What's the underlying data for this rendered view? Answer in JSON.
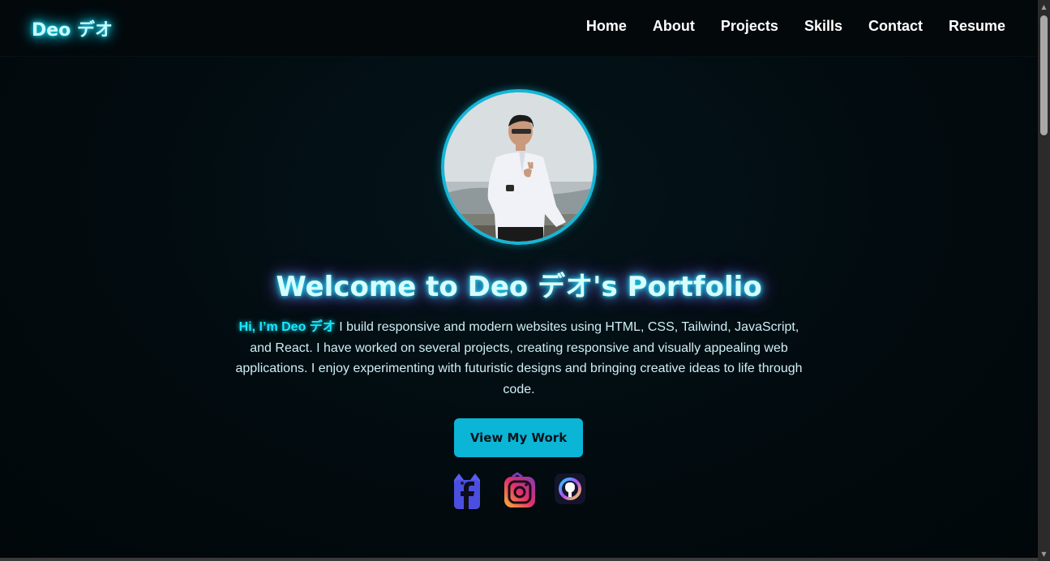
{
  "navbar": {
    "logo": "Deo デオ",
    "links": [
      "Home",
      "About",
      "Projects",
      "Skills",
      "Contact",
      "Resume"
    ]
  },
  "hero": {
    "title": "Welcome to Deo デオ's Portfolio",
    "intro_highlight": "Hi, I’m Deo デオ",
    "intro_text": " I build responsive and modern websites using HTML, CSS, Tailwind, JavaScript, and React. I have worked on several projects, creating responsive and visually appealing web applications. I enjoy experimenting with futuristic designs and bringing creative ideas to life through code.",
    "cta_label": "View My Work"
  },
  "socials": [
    {
      "icon": "facebook-icon"
    },
    {
      "icon": "instagram-icon"
    },
    {
      "icon": "github-icon"
    }
  ],
  "colors": {
    "accent": "#0bb5d6",
    "neon_cyan": "#19e8ff",
    "glow_purple": "#a23bd8",
    "background": "#020b0f"
  }
}
